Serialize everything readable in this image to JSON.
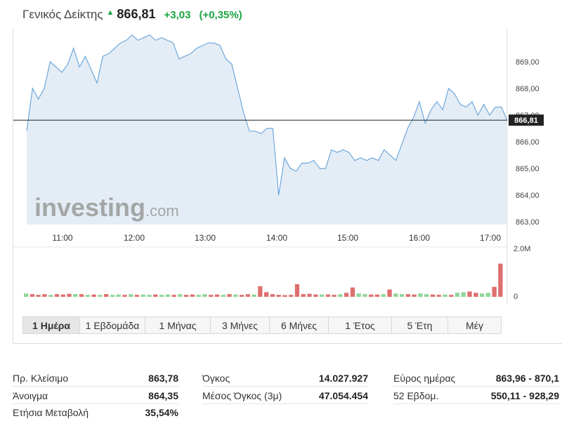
{
  "header": {
    "index_name": "Γενικός Δείκτης",
    "arrow": "▲",
    "price": "866,81",
    "change": "+3,03",
    "change_pct": "(+0,35%)"
  },
  "colors": {
    "up": "#1aa442",
    "down": "#d9534f",
    "line": "#6fa8dc",
    "area": "#e4edf6",
    "vol_up": "#8fd59a",
    "vol_down": "#de6f6f"
  },
  "watermark": {
    "brand": "investing",
    "suffix": ".com"
  },
  "chart_data": {
    "type": "area",
    "x_labels": [
      "11:00",
      "12:00",
      "13:00",
      "14:00",
      "15:00",
      "16:00",
      "17:00"
    ],
    "y_ticks": [
      "863,00",
      "864,00",
      "865,00",
      "866,00",
      "867,00",
      "868,00",
      "869,00"
    ],
    "ylim": [
      862.9,
      870.1
    ],
    "reference_line": 866.81,
    "current_label": "866,81",
    "price": [
      866.4,
      868.0,
      867.6,
      868.0,
      869.0,
      868.8,
      868.6,
      868.9,
      869.5,
      868.8,
      869.2,
      868.7,
      868.2,
      869.2,
      869.3,
      869.5,
      869.7,
      869.8,
      870.0,
      869.8,
      869.9,
      870.0,
      869.8,
      869.9,
      869.8,
      869.7,
      869.1,
      869.2,
      869.3,
      869.5,
      869.6,
      869.7,
      869.7,
      869.6,
      869.1,
      868.9,
      868.0,
      867.1,
      866.4,
      866.4,
      866.3,
      866.5,
      866.5,
      864.0,
      865.4,
      865.0,
      864.9,
      865.2,
      865.2,
      865.3,
      865.0,
      865.0,
      865.7,
      865.6,
      865.7,
      865.6,
      865.3,
      865.4,
      865.3,
      865.4,
      865.3,
      865.7,
      865.5,
      865.3,
      865.9,
      866.5,
      866.9,
      867.5,
      866.7,
      867.2,
      867.5,
      867.2,
      868.0,
      867.8,
      867.4,
      867.3,
      867.5,
      867.0,
      867.4,
      867.0,
      867.3,
      867.3,
      866.8
    ],
    "volume_axis": [
      "2.0M",
      "0"
    ],
    "volume": [
      0.1,
      0.08,
      0.06,
      0.08,
      0.06,
      0.08,
      0.07,
      0.09,
      0.08,
      0.08,
      0.06,
      0.07,
      0.06,
      0.08,
      0.06,
      0.07,
      0.06,
      0.08,
      0.06,
      0.07,
      0.06,
      0.07,
      0.06,
      0.07,
      0.06,
      0.08,
      0.06,
      0.07,
      0.06,
      0.08,
      0.06,
      0.07,
      0.06,
      0.08,
      0.07,
      0.06,
      0.08,
      0.07,
      0.32,
      0.14,
      0.08,
      0.06,
      0.05,
      0.06,
      0.38,
      0.08,
      0.09,
      0.07,
      0.07,
      0.07,
      0.06,
      0.08,
      0.12,
      0.28,
      0.1,
      0.08,
      0.07,
      0.07,
      0.08,
      0.22,
      0.1,
      0.08,
      0.08,
      0.07,
      0.1,
      0.08,
      0.07,
      0.06,
      0.07,
      0.06,
      0.12,
      0.14,
      0.16,
      0.12,
      0.1,
      0.12,
      0.3,
      1.0
    ],
    "volume_max": 1.5,
    "volume_dir": [
      "u",
      "d",
      "d",
      "d",
      "u",
      "d",
      "d",
      "d",
      "u",
      "d",
      "u",
      "d",
      "u",
      "d",
      "u",
      "u",
      "d",
      "u",
      "d",
      "u",
      "u",
      "d",
      "u",
      "u",
      "d",
      "u",
      "d",
      "d",
      "u",
      "u",
      "d",
      "d",
      "u",
      "d",
      "u",
      "d",
      "d",
      "u",
      "d",
      "d",
      "d",
      "d",
      "d",
      "d",
      "d",
      "d",
      "d",
      "d",
      "u",
      "d",
      "d",
      "u",
      "d",
      "d",
      "u",
      "u",
      "d",
      "d",
      "u",
      "d",
      "u",
      "u",
      "d",
      "d",
      "u",
      "u",
      "d",
      "d",
      "u",
      "d",
      "u",
      "u",
      "d",
      "d",
      "u",
      "u",
      "d",
      "d",
      "d",
      "d",
      "u",
      "d",
      "d",
      "d"
    ]
  },
  "periods": [
    {
      "label": "1 Ημέρα",
      "active": true
    },
    {
      "label": "1 Εβδομάδα",
      "active": false
    },
    {
      "label": "1 Μήνας",
      "active": false
    },
    {
      "label": "3 Μήνες",
      "active": false
    },
    {
      "label": "6 Μήνες",
      "active": false
    },
    {
      "label": "1 Έτος",
      "active": false
    },
    {
      "label": "5 Έτη",
      "active": false
    },
    {
      "label": "Μέγ",
      "active": false
    }
  ],
  "stats": {
    "prev_close": {
      "label": "Πρ. Κλείσιμο",
      "value": "863,78"
    },
    "open": {
      "label": "Άνοιγμα",
      "value": "864,35"
    },
    "annual_change": {
      "label": "Ετήσια Μεταβολή",
      "value": "35,54%"
    },
    "volume": {
      "label": "Όγκος",
      "value": "14.027.927"
    },
    "avg_volume": {
      "label": "Μέσος Όγκος (3μ)",
      "value": "47.054.454"
    },
    "day_range": {
      "label": "Εύρος ημέρας",
      "value": "863,96 - 870,1"
    },
    "week52": {
      "label": "52 Εβδομ.",
      "value": "550,11 - 928,29"
    }
  }
}
